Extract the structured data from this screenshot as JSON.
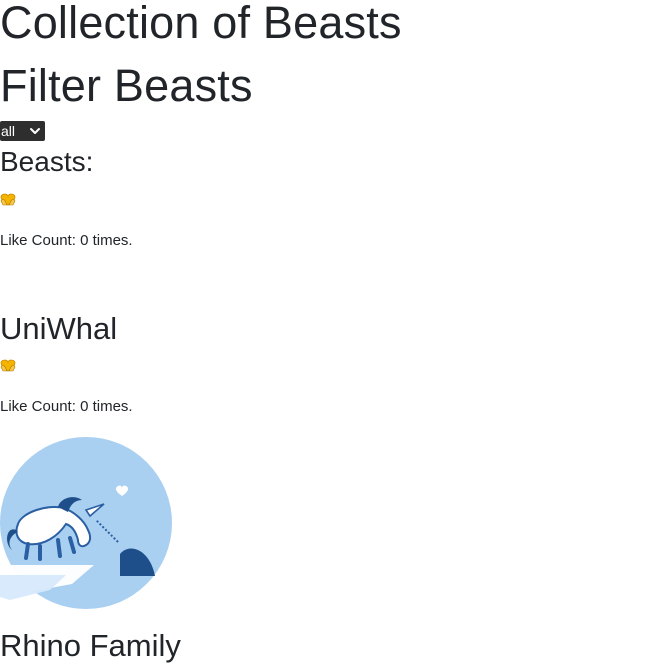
{
  "page": {
    "title": "Collection of Beasts",
    "filter_heading": "Filter Beasts",
    "filter_select": {
      "value": "all"
    },
    "beasts_heading": "Beasts:"
  },
  "beasts": [
    {
      "title": "",
      "like_label": "Like Count:",
      "like_count": "0",
      "like_suffix": "times.",
      "icon": "hands-heart-icon"
    },
    {
      "title": "UniWhal",
      "like_label": "Like Count:",
      "like_count": "0",
      "like_suffix": "times.",
      "icon": "hands-heart-icon",
      "image": "unicorn-narwhal-illustration"
    },
    {
      "title": "Rhino Family"
    }
  ],
  "colors": {
    "text": "#212529",
    "select_bg": "#2e2e2e",
    "heart_yellow": "#f4b400",
    "image_circle": "#a9cff1",
    "image_dark": "#1f4f8a"
  }
}
